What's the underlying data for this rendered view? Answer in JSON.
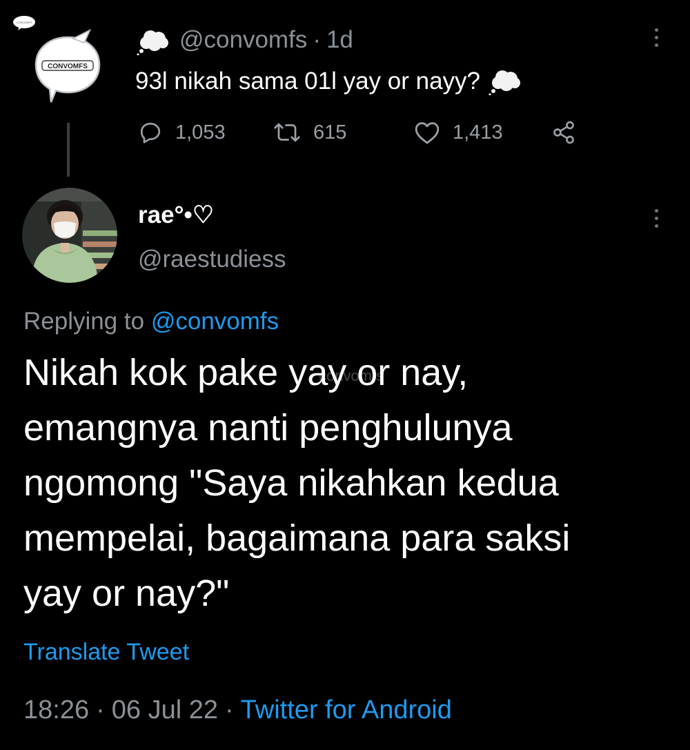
{
  "parent_tweet": {
    "handle": "@convomfs",
    "separator": "·",
    "time_ago": "1d",
    "text": "93l nikah sama 01l yay or nayy?",
    "avatar_logo_text": "CONVOMFS",
    "corner_logo_text": "CONVOMFS",
    "emoji_icon": "thought-balloon-icon",
    "stats": {
      "replies": "1,053",
      "retweets": "615",
      "likes": "1,413"
    }
  },
  "reply_tweet": {
    "display_name": "rae°•♡",
    "handle": "@raestudiess",
    "replying_to_label": "Replying to",
    "replying_to_handle": "@convomfs",
    "body_lines": [
      "Nikah kok pake yay or nay,",
      "emangnya nanti penghulunya",
      "ngomong \"Saya nikahkan kedua",
      "mempelai, bagaimana para saksi",
      "yay or nay?\""
    ],
    "watermark": "convomfs",
    "translate_label": "Translate Tweet",
    "time": "18:26",
    "date": "06 Jul 22",
    "separator": "·",
    "source": "Twitter for Android"
  },
  "colors": {
    "background": "#000000",
    "text_primary": "#ffffff",
    "text_secondary": "#8b9196",
    "link": "#1d9bf0",
    "thread_line": "#3a3d40"
  }
}
